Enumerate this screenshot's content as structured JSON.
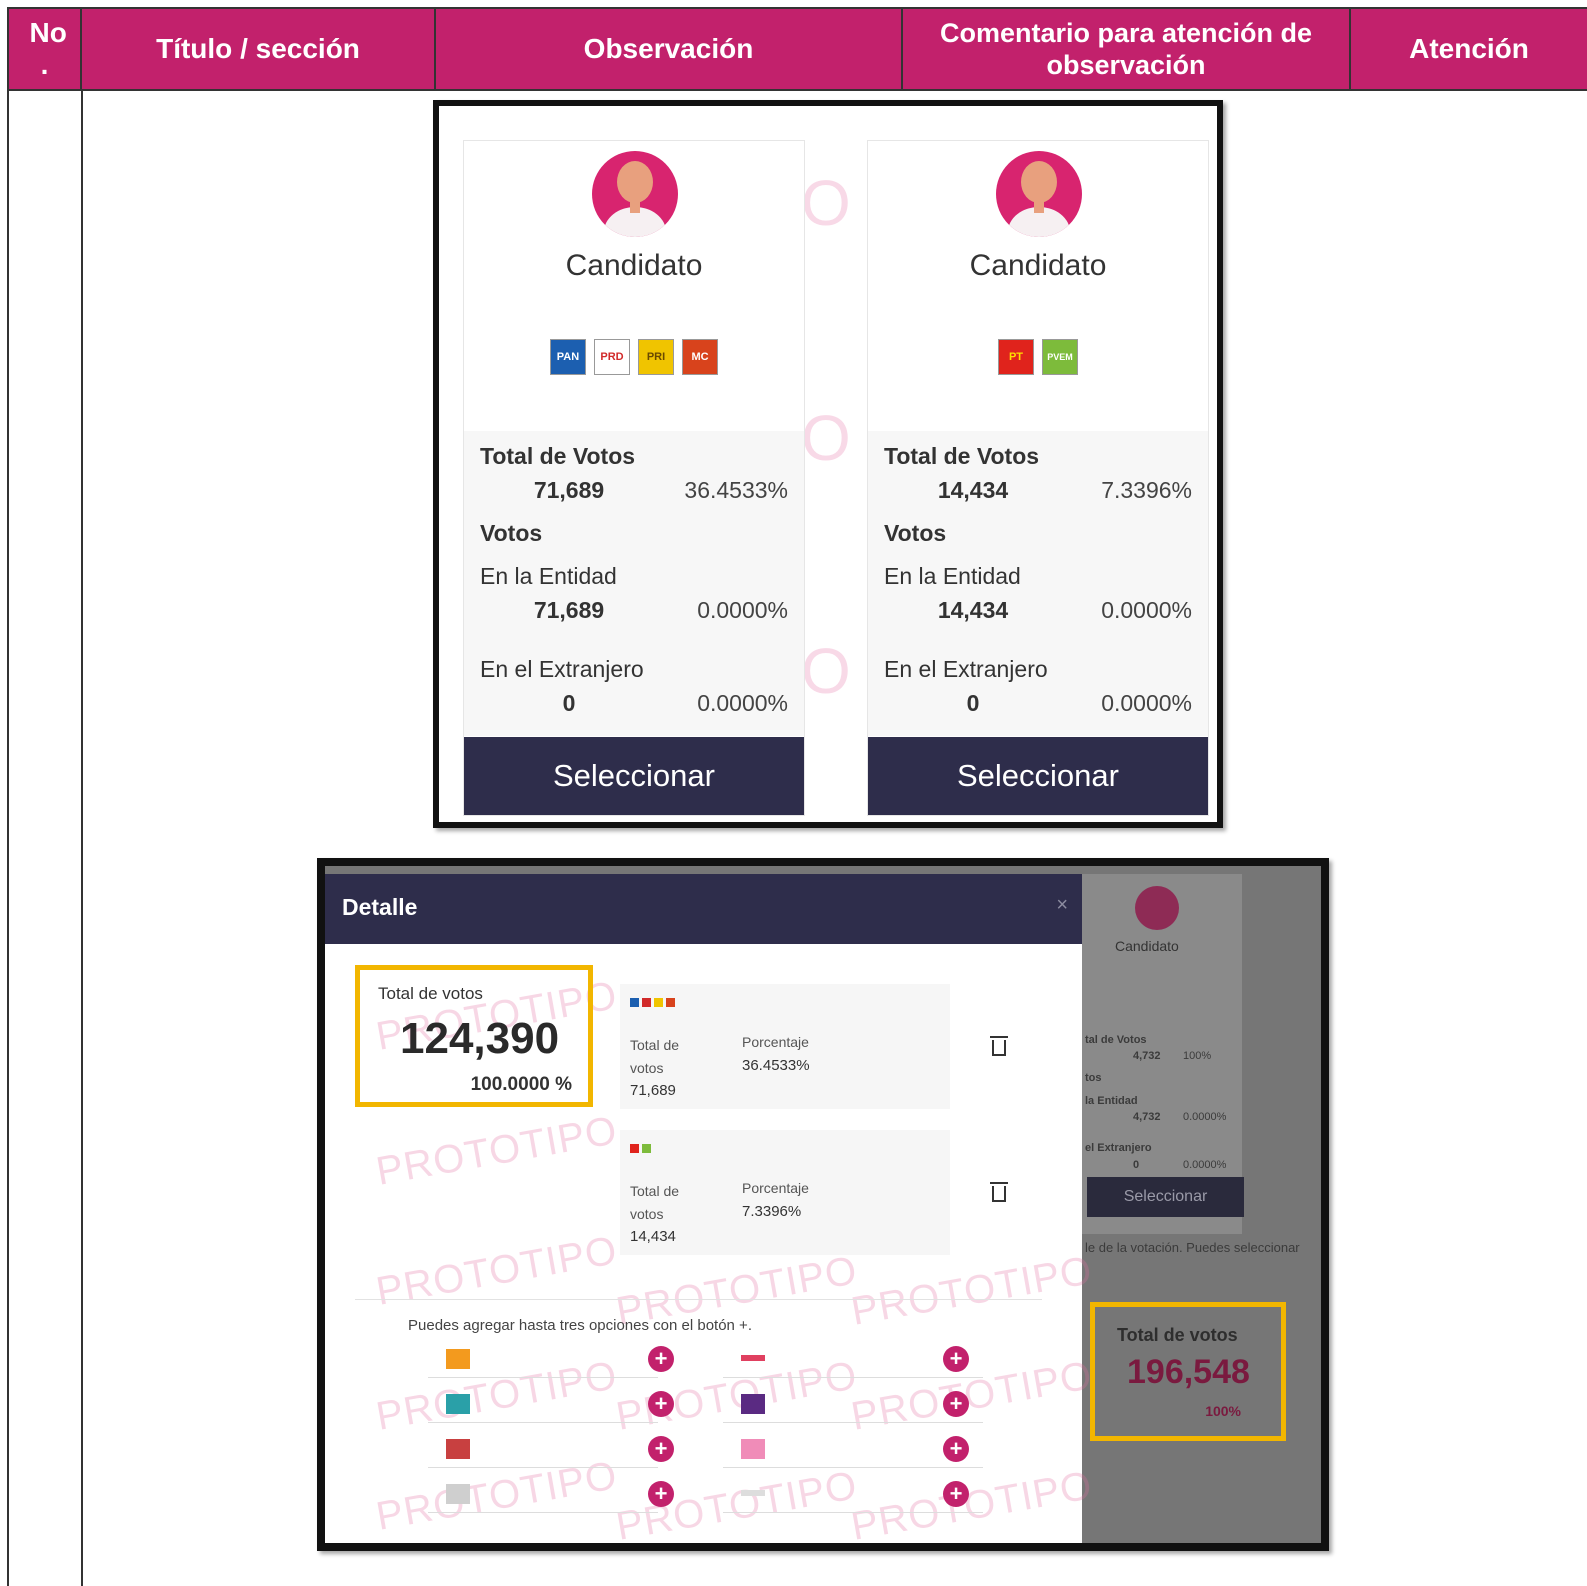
{
  "table": {
    "headers": {
      "no": "No .",
      "titulo": "Título / sección",
      "observacion": "Observación",
      "comentario": "Comentario para atención de observación",
      "atencion": "Atención"
    }
  },
  "candidates": [
    {
      "name": "Candidato",
      "parties": [
        "PAN",
        "PRD",
        "PRI",
        "MC"
      ],
      "total_label": "Total de Votos",
      "total": "71,689",
      "total_pct": "36.4533%",
      "votos_label": "Votos",
      "entidad_label": "En la Entidad",
      "entidad": "71,689",
      "entidad_pct": "0.0000%",
      "extranjero_label": "En el Extranjero",
      "extranjero": "0",
      "extranjero_pct": "0.0000%",
      "button": "Seleccionar"
    },
    {
      "name": "Candidato",
      "parties": [
        "PT",
        "PVEM"
      ],
      "total_label": "Total de Votos",
      "total": "14,434",
      "total_pct": "7.3396%",
      "votos_label": "Votos",
      "entidad_label": "En la Entidad",
      "entidad": "14,434",
      "entidad_pct": "0.0000%",
      "extranjero_label": "En el Extranjero",
      "extranjero": "0",
      "extranjero_pct": "0.0000%",
      "button": "Seleccionar"
    }
  ],
  "detail": {
    "title": "Detalle",
    "close": "×",
    "total_label": "Total de votos",
    "total": "124,390",
    "total_pct": "100.0000 %",
    "options": [
      {
        "votes_label": "Total de votos",
        "pct_label": "Porcentaje",
        "votes": "71,689",
        "pct": "36.4533%"
      },
      {
        "votes_label": "Total de votos",
        "pct_label": "Porcentaje",
        "votes": "14,434",
        "pct": "7.3396%"
      }
    ],
    "hint": "Puedes agregar hasta tres opciones con el botón +.",
    "plus": "+",
    "watermark": "PROTOTIPO"
  },
  "background_panel": {
    "candidate": "Candidato",
    "total_votes_label": "tal de Votos",
    "total_votes": "4,732",
    "total_pct": "100%",
    "votos": "tos",
    "entidad_label": "la Entidad",
    "entidad": "4,732",
    "entidad_pct": "0.0000%",
    "extranjero_label": "el Extranjero",
    "extranjero": "0",
    "extranjero_pct": "0.0000%",
    "button": "Seleccionar",
    "note": "le de la votación. Puedes seleccionar",
    "total_label": "Total de votos",
    "total": "196,548"
  },
  "colors": {
    "header_bg": "#c2216c",
    "button_bg": "#2e2d4b",
    "highlight": "#f2b600",
    "avatar": "#d8246f"
  }
}
